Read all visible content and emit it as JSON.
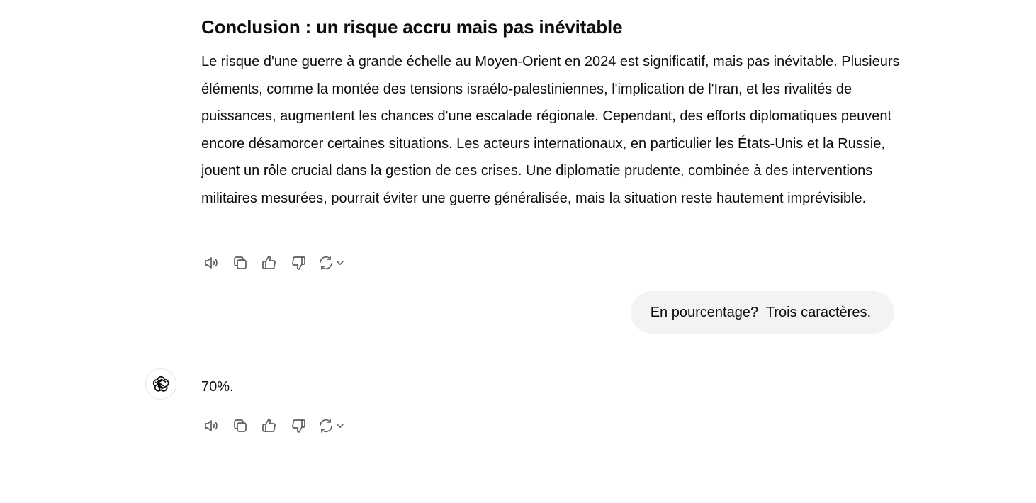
{
  "conversation": {
    "assistant_1": {
      "heading": "Conclusion : un risque accru mais pas inévitable",
      "paragraph": "Le risque d'une guerre à grande échelle au Moyen-Orient en 2024 est significatif, mais pas inévitable. Plusieurs éléments, comme la montée des tensions israélo-palestiniennes, l'implication de l'Iran, et les rivalités de puissances, augmentent les chances d'une escalade régionale. Cependant, des efforts diplomatiques peuvent encore désamorcer certaines situations. Les acteurs internationaux, en particulier les États-Unis et la Russie, jouent un rôle crucial dans la gestion de ces crises. Une diplomatie prudente, combinée à des interventions militaires mesurées, pourrait éviter une guerre généralisée, mais la situation reste hautement imprévisible."
    },
    "user_1": {
      "text": "En pourcentage?  Trois caractères."
    },
    "assistant_2": {
      "text": "70%."
    }
  },
  "actions": {
    "icons": [
      "speaker-icon",
      "copy-icon",
      "thumbs-up-icon",
      "thumbs-down-icon",
      "regenerate-icon",
      "chevron-down-icon"
    ]
  },
  "colors": {
    "text": "#0d0d0d",
    "icon": "#5d5d5d",
    "user_bubble": "#f3f3f3",
    "background": "#ffffff"
  }
}
